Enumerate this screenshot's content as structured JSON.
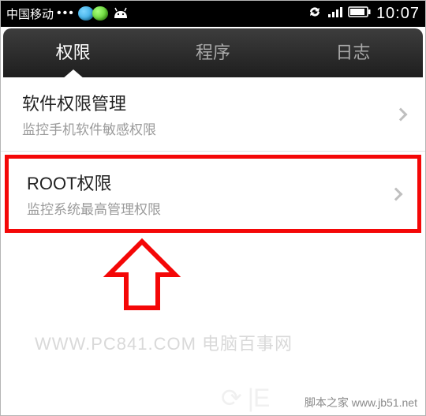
{
  "status": {
    "carrier": "中国移动",
    "dots": "•••",
    "time": "10:07"
  },
  "tabs": {
    "t0": "权限",
    "t1": "程序",
    "t2": "日志"
  },
  "items": {
    "i0": {
      "title": "软件权限管理",
      "subtitle": "监控手机软件敏感权限"
    },
    "i1": {
      "title": "ROOT权限",
      "subtitle": "监控系统最高管理权限"
    }
  },
  "watermarks": {
    "a": "WWW.PC841.COM 电脑百事网",
    "b": "脚本之家 www.jb51.net"
  }
}
